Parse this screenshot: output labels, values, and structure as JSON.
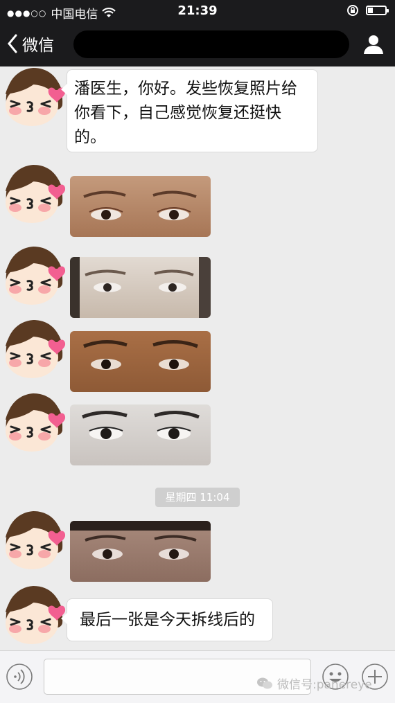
{
  "status_bar": {
    "signal": "●●●○○",
    "carrier": "中国电信",
    "time": "21:39",
    "battery_level": 0.25,
    "icons": [
      "signal-dots-icon",
      "wifi-icon",
      "rotation-lock-icon",
      "battery-icon"
    ]
  },
  "nav": {
    "back_label": "微信",
    "title_redacted": true,
    "icons": [
      "chevron-left-icon",
      "profile-icon"
    ]
  },
  "messages": [
    {
      "type": "text",
      "text": "潘医生，你好。发些恢复照片给你看下，自己感觉恢复还挺快的。"
    },
    {
      "type": "image",
      "icon": "eye-photo"
    },
    {
      "type": "image",
      "icon": "eye-photo"
    },
    {
      "type": "image",
      "icon": "eye-photo"
    },
    {
      "type": "image",
      "icon": "eye-photo"
    },
    {
      "type": "timestamp",
      "text": "星期四 11:04"
    },
    {
      "type": "image",
      "icon": "eye-photo"
    },
    {
      "type": "text",
      "text": "最后一张是今天拆线后的"
    }
  ],
  "input_bar": {
    "icons": [
      "voice-icon",
      "emoji-icon",
      "plus-icon"
    ]
  },
  "watermark": {
    "text": "微信号:panereye",
    "icon": "wechat-logo-icon"
  },
  "colors": {
    "nav_background": "#1b1b1d",
    "chat_background": "#ececec",
    "bubble_background": "#ffffff",
    "timestamp_background": "#cfcfcf"
  }
}
